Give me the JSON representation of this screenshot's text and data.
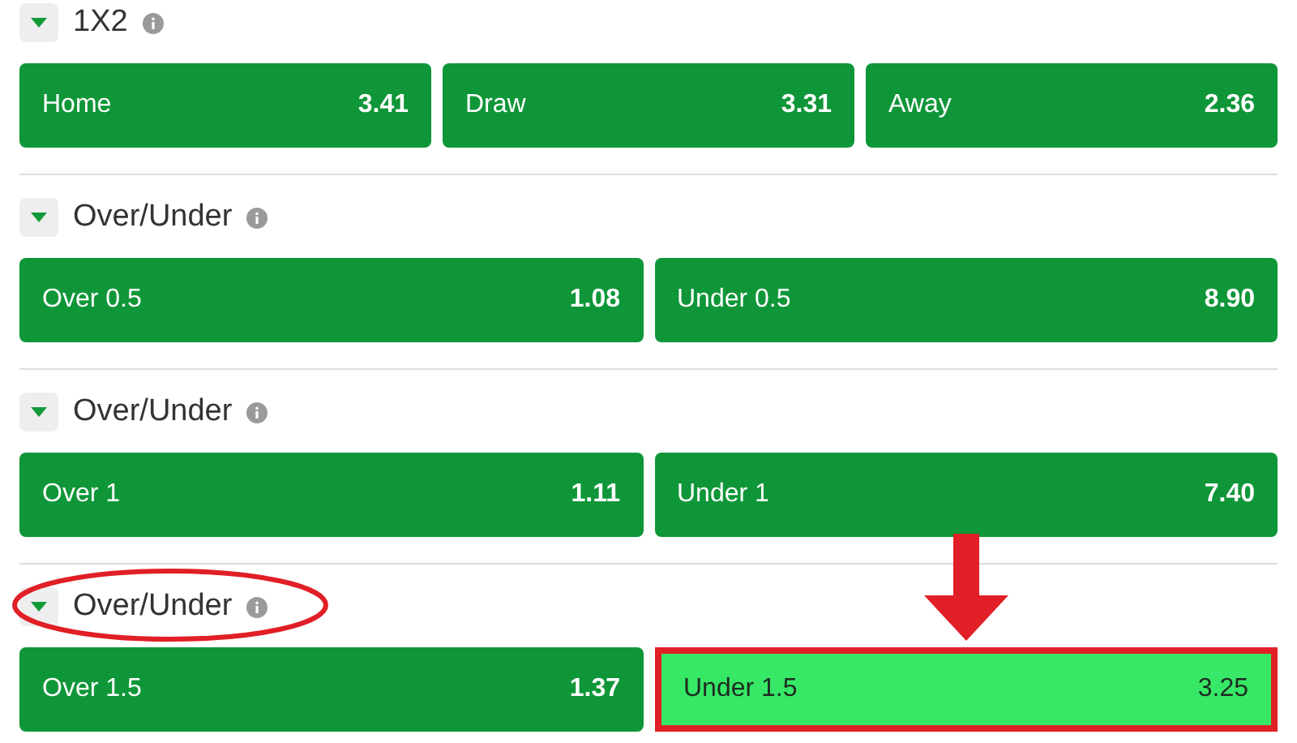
{
  "markets": [
    {
      "title": "1X2",
      "expanded": true,
      "circled": false,
      "outcomes": [
        {
          "label": "Home",
          "odds": "3.41",
          "selected": false
        },
        {
          "label": "Draw",
          "odds": "3.31",
          "selected": false
        },
        {
          "label": "Away",
          "odds": "2.36",
          "selected": false
        }
      ]
    },
    {
      "title": "Over/Under",
      "expanded": true,
      "circled": false,
      "outcomes": [
        {
          "label": "Over 0.5",
          "odds": "1.08",
          "selected": false
        },
        {
          "label": "Under 0.5",
          "odds": "8.90",
          "selected": false
        }
      ]
    },
    {
      "title": "Over/Under",
      "expanded": true,
      "circled": false,
      "outcomes": [
        {
          "label": "Over 1",
          "odds": "1.11",
          "selected": false
        },
        {
          "label": "Under 1",
          "odds": "7.40",
          "selected": false
        }
      ]
    },
    {
      "title": "Over/Under",
      "expanded": true,
      "circled": true,
      "outcomes": [
        {
          "label": "Over 1.5",
          "odds": "1.37",
          "selected": false
        },
        {
          "label": "Under 1.5",
          "odds": "3.25",
          "selected": true
        }
      ]
    }
  ]
}
